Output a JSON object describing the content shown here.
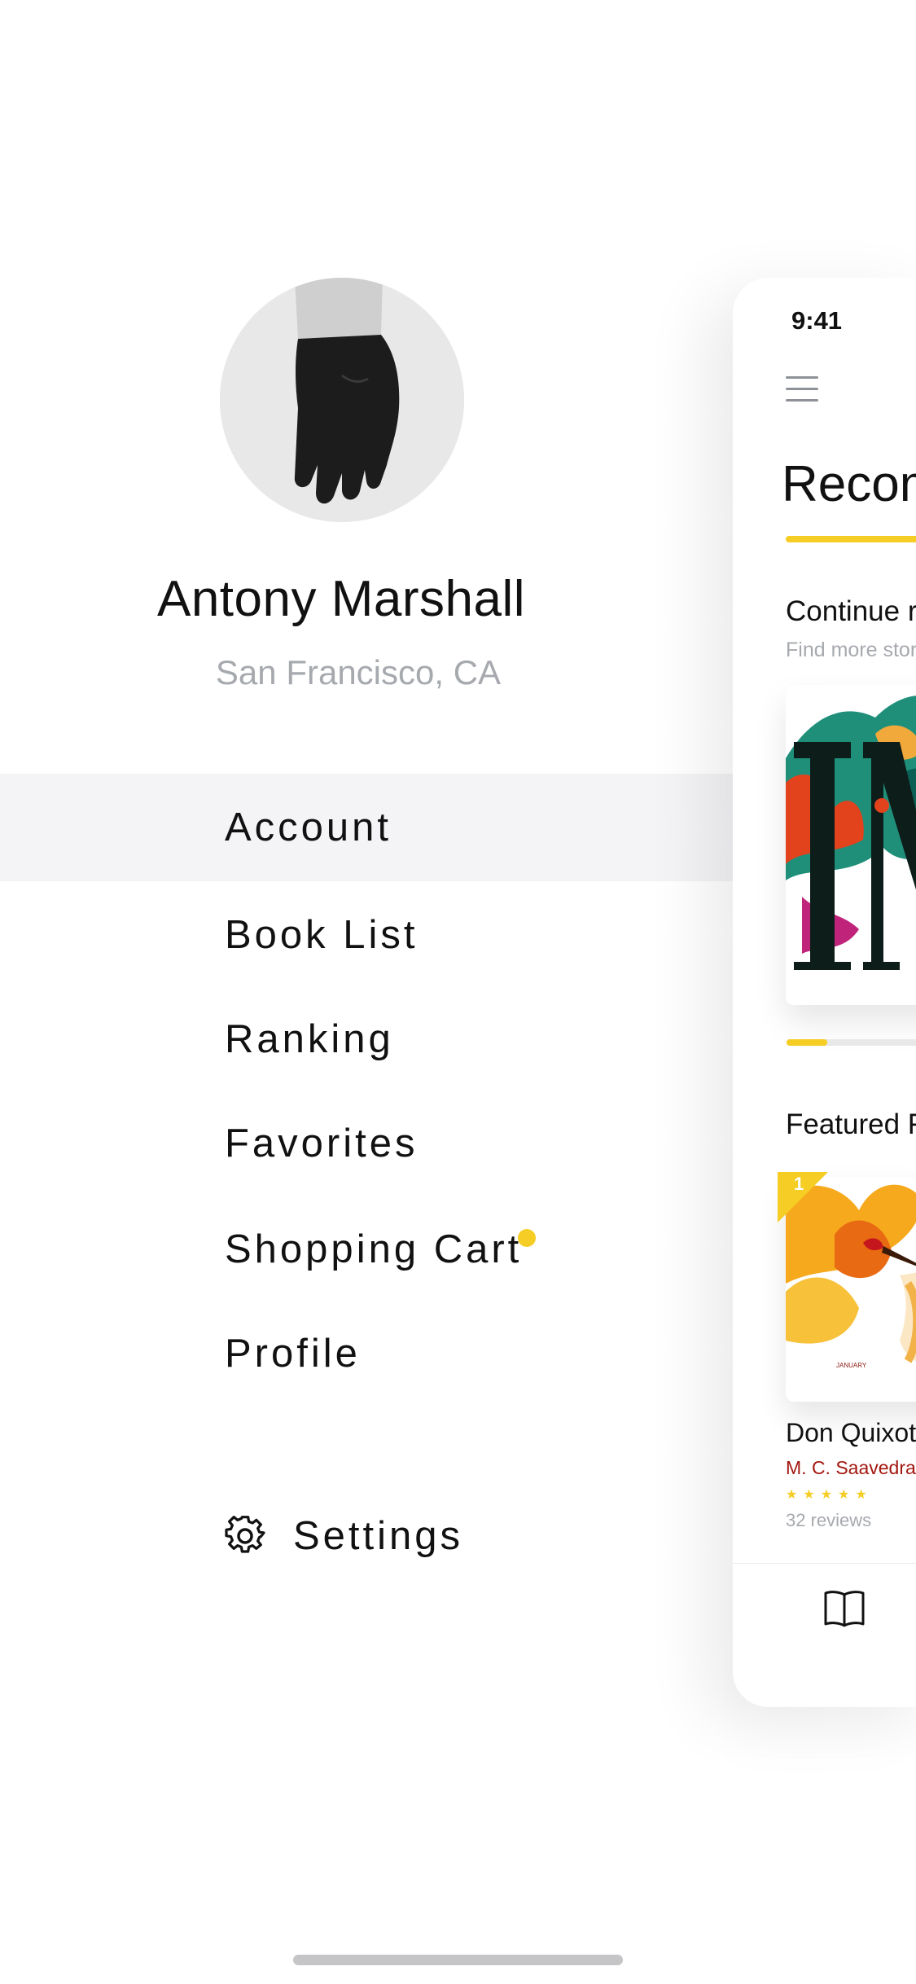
{
  "profile": {
    "name": "Antony Marshall",
    "location": "San Francisco, CA",
    "avatar_icon": "hand-photo"
  },
  "menu": {
    "items": [
      {
        "label": "Account",
        "active": true
      },
      {
        "label": "Book List",
        "active": false
      },
      {
        "label": "Ranking",
        "active": false
      },
      {
        "label": "Favorites",
        "active": false
      },
      {
        "label": "Shopping Cart",
        "active": false,
        "badge_dot": true
      },
      {
        "label": "Profile",
        "active": false
      }
    ],
    "settings": {
      "label": "Settings",
      "icon": "gear-icon"
    }
  },
  "app_preview": {
    "status_time": "9:41",
    "menu_icon": "hamburger-icon",
    "heading": "Recom",
    "continue_section": {
      "title": "Continue r",
      "subtitle": "Find more stor",
      "progress": 0.25
    },
    "featured_section": {
      "title": "Featured F",
      "rank": "1",
      "book": {
        "title": "Don Quixote",
        "author": "M. C. Saavedra",
        "rating": 5,
        "reviews": "32 reviews"
      }
    },
    "tab_icon": "book-icon"
  },
  "colors": {
    "accent": "#f5cd24",
    "text": "#111111",
    "muted": "#a6a9ae",
    "author": "#a3170f",
    "active_row": "#f4f4f7"
  }
}
